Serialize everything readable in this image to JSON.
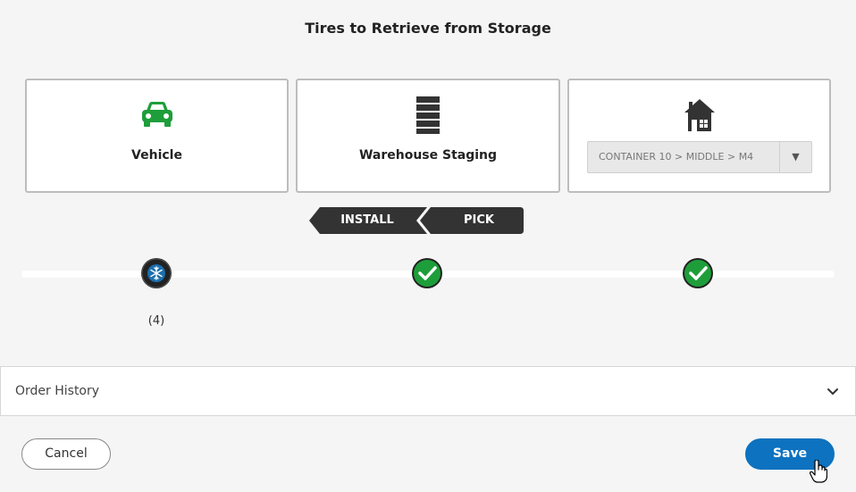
{
  "page": {
    "title": "Tires to Retrieve from Storage"
  },
  "cards": {
    "vehicle": {
      "label": "Vehicle",
      "icon": "car-icon",
      "color": "#1e9e3a"
    },
    "staging": {
      "label": "Warehouse Staging",
      "icon": "shelving-icon"
    },
    "storage": {
      "icon": "warehouse-icon",
      "location_value": "CONTAINER 10 > MIDDLE > M4"
    }
  },
  "steps": {
    "install_label": "INSTALL",
    "pick_label": "PICK"
  },
  "progress": {
    "tire_count": "(4)",
    "nodes": [
      {
        "icon": "snowflake-tire-icon"
      },
      {
        "icon": "check-icon",
        "color": "#1e9e3a"
      },
      {
        "icon": "check-icon",
        "color": "#1e9e3a"
      }
    ]
  },
  "history": {
    "label": "Order History"
  },
  "footer": {
    "cancel_label": "Cancel",
    "save_label": "Save",
    "save_color": "#0d72bf"
  }
}
